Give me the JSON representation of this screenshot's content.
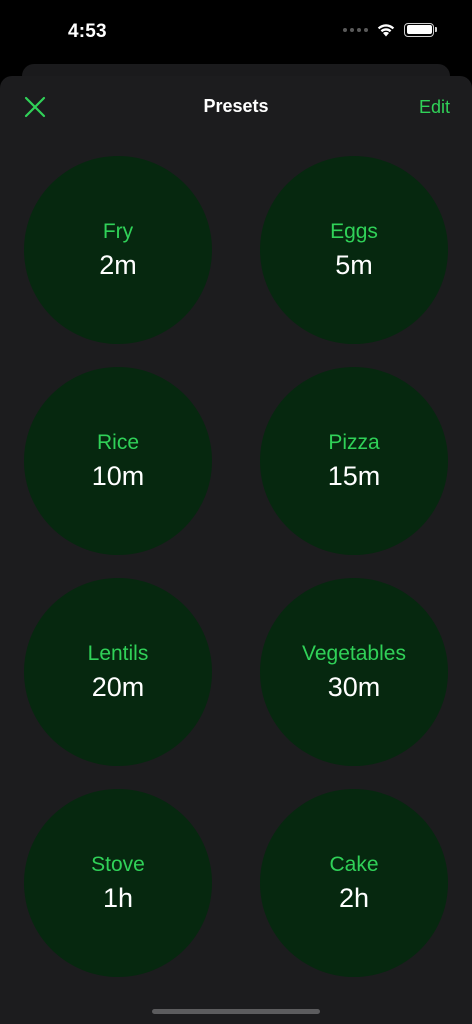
{
  "status_bar": {
    "time": "4:53"
  },
  "nav": {
    "title": "Presets",
    "edit_label": "Edit",
    "close_icon": "close-x-icon"
  },
  "colors": {
    "accent": "#30d158",
    "preset_fill": "#06280f",
    "sheet_bg": "#1c1c1e"
  },
  "presets": [
    {
      "name": "Fry",
      "time": "2m"
    },
    {
      "name": "Eggs",
      "time": "5m"
    },
    {
      "name": "Rice",
      "time": "10m"
    },
    {
      "name": "Pizza",
      "time": "15m"
    },
    {
      "name": "Lentils",
      "time": "20m"
    },
    {
      "name": "Vegetables",
      "time": "30m"
    },
    {
      "name": "Stove",
      "time": "1h"
    },
    {
      "name": "Cake",
      "time": "2h"
    }
  ]
}
